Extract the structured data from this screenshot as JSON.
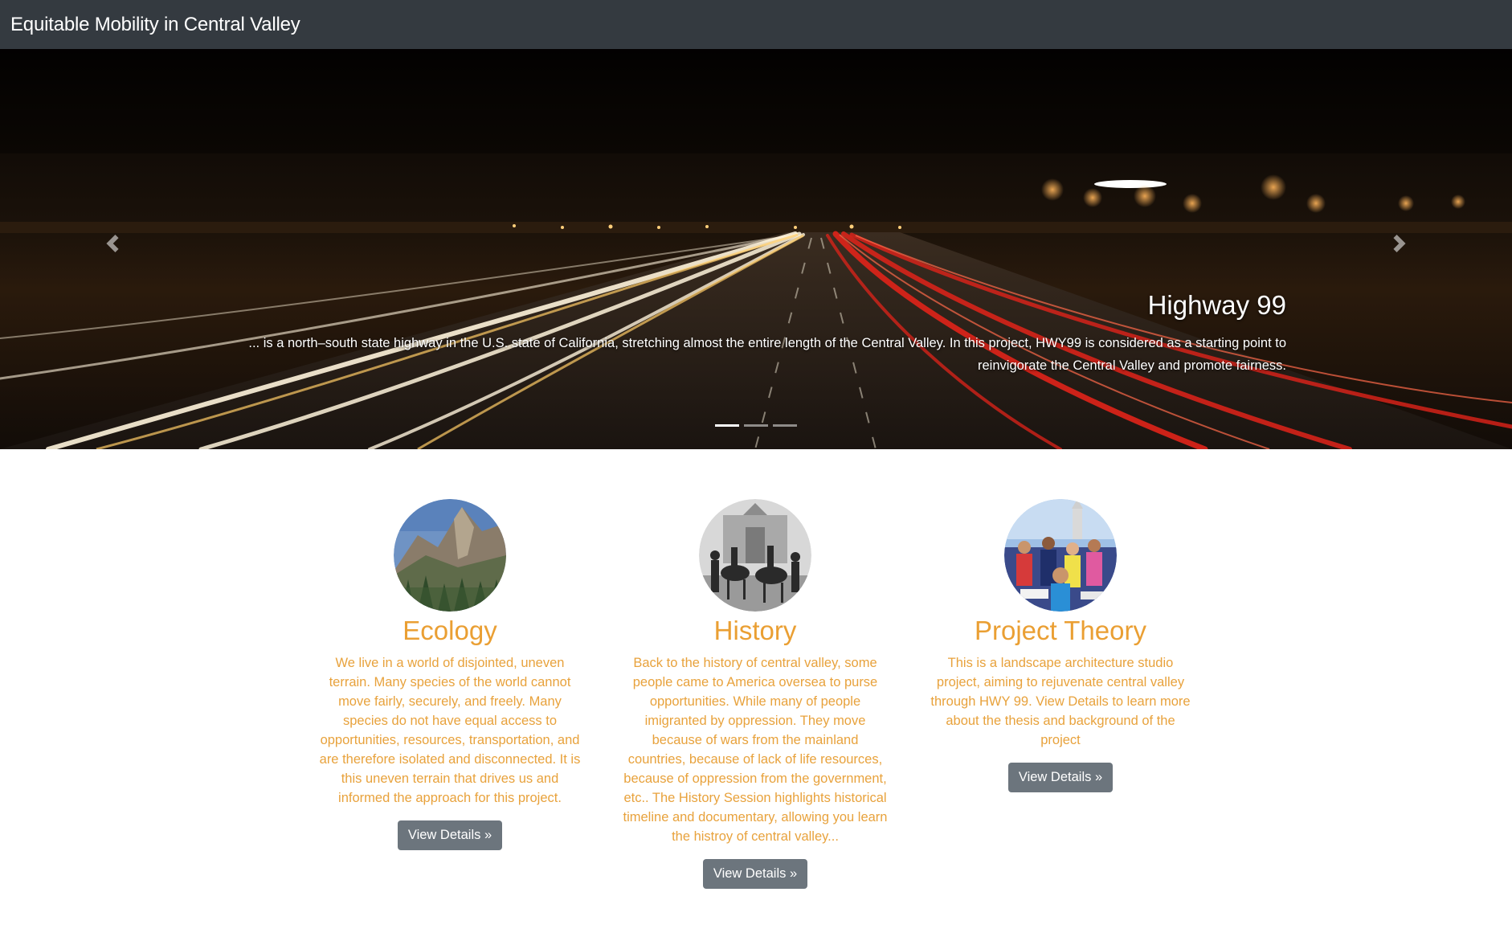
{
  "navbar": {
    "brand": "Equitable Mobility in Central Valley"
  },
  "carousel": {
    "prev_icon": "chevron-left-icon",
    "next_icon": "chevron-right-icon",
    "slide_count": 3,
    "active_slide": 1,
    "caption": {
      "title": "Highway 99",
      "text": "... is a north–south state highway in the U.S. state of California, stretching almost the entire length of the Central Valley. In this project, HWY99 is considered as a starting point to reinvigorate the Central Valley and promote fairness."
    }
  },
  "features": [
    {
      "title": "Ecology",
      "text": "We live in a world of disjointed, uneven terrain. Many species of the world cannot move fairly, securely, and freely. Many species do not have equal access to opportunities, resources, transportation, and are therefore isolated and disconnected. It is this uneven terrain that drives us and informed the approach for this project.",
      "button": "View Details »"
    },
    {
      "title": "History",
      "text": "Back to the history of central valley, some people came to America oversea to purse opportunities. While many of people imigranted by oppression. They move because of wars from the mainland countries, because of lack of life resources, because of oppression from the government, etc.. The History Session highlights historical timeline and documentary, allowing you learn the histroy of central valley...",
      "button": "View Details »"
    },
    {
      "title": "Project Theory",
      "text": "This is a landscape architecture studio project, aiming to rejuvenate central valley through HWY 99. View Details to learn more about the thesis and background of the project",
      "button": "View Details »"
    }
  ],
  "colors": {
    "navbar_bg": "#343a40",
    "accent": "#ea9f33",
    "button_bg": "#6c757d"
  }
}
